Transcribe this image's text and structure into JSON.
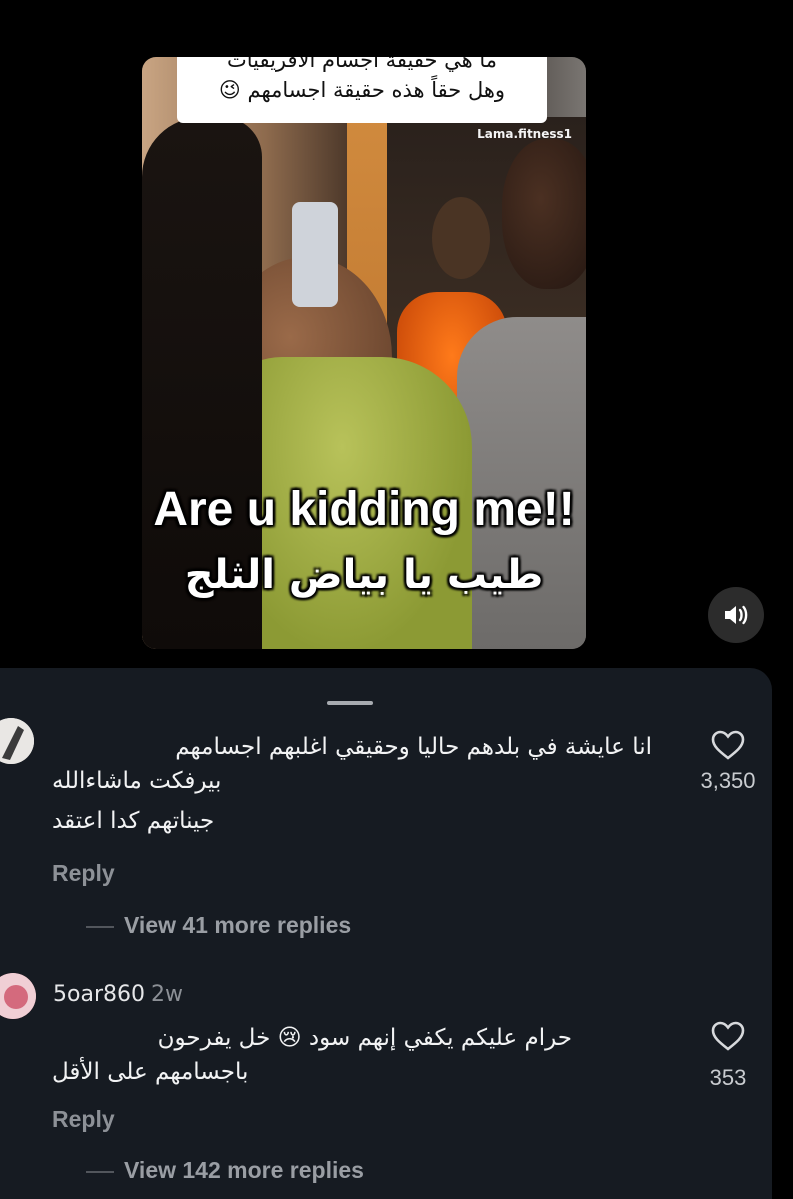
{
  "video": {
    "caption_line1": "ما هي حقيقة اجسام الافريقيات",
    "caption_line2": "وهل حقاً هذه حقيقة اجسامهم 😉",
    "watermark": "Lama.fitness1",
    "overlay_english": "Are u kidding me!!",
    "overlay_arabic": "طيب يا بياض الثلج",
    "sound_icon": "speaker-icon"
  },
  "comments": [
    {
      "username": "",
      "time": "",
      "line1": "انا عايشة في بلدهم حاليا وحقيقي اغلبهم اجسامهم",
      "line2": "بيرفكت ماشاءالله",
      "line3": "جيناتهم كدا اعتقد",
      "reply_label": "Reply",
      "view_more": "View 41 more replies",
      "likes": "3,350"
    },
    {
      "username": "5oar860",
      "time": "2w",
      "line1": "حرام عليكم يكفي إنهم سود 😢 خل يفرحون",
      "line2": "باجسامهم على الأقل",
      "reply_label": "Reply",
      "view_more": "View 142 more replies",
      "likes": "353"
    }
  ],
  "colors": {
    "sheet_bg": "#161b22",
    "muted_text": "#8d9197"
  }
}
